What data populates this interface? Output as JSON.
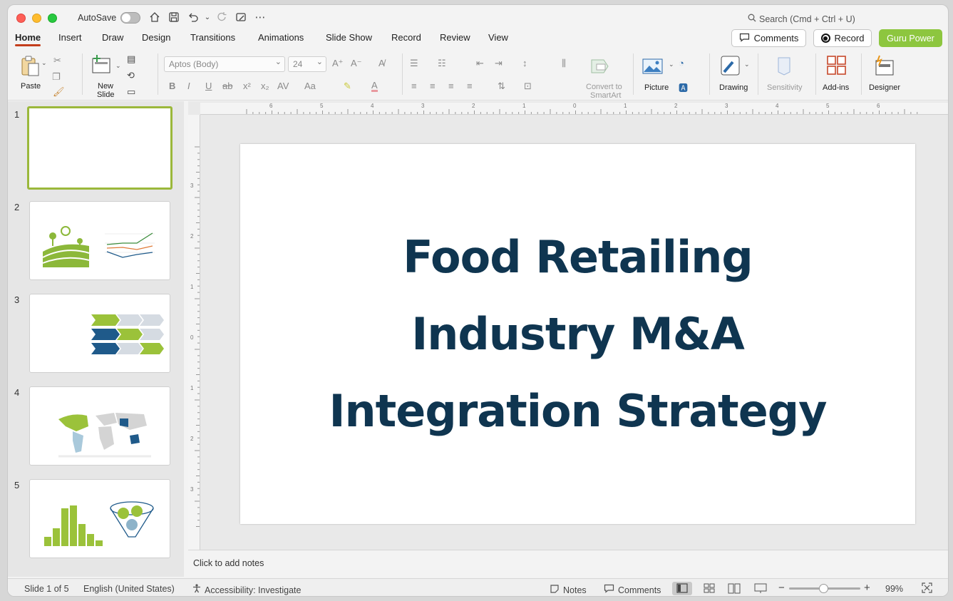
{
  "titlebar": {
    "autosave_label": "AutoSave",
    "search_placeholder": "Search (Cmd + Ctrl + U)"
  },
  "tabs": [
    {
      "label": "Home",
      "active": true
    },
    {
      "label": "Insert"
    },
    {
      "label": "Draw"
    },
    {
      "label": "Design"
    },
    {
      "label": "Transitions"
    },
    {
      "label": "Animations"
    },
    {
      "label": "Slide Show"
    },
    {
      "label": "Record"
    },
    {
      "label": "Review"
    },
    {
      "label": "View"
    }
  ],
  "actions": {
    "comments": "Comments",
    "record": "Record",
    "guru": "Guru Power"
  },
  "ribbon": {
    "paste": "Paste",
    "new_slide_line1": "New",
    "new_slide_line2": "Slide",
    "font_name": "Aptos (Body)",
    "font_size": "24",
    "smartart_line1": "Convert to",
    "smartart_line2": "SmartArt",
    "picture": "Picture",
    "drawing": "Drawing",
    "sensitivity": "Sensitivity",
    "addins": "Add-ins",
    "designer": "Designer"
  },
  "slides": [
    {
      "number": "1"
    },
    {
      "number": "2"
    },
    {
      "number": "3"
    },
    {
      "number": "4"
    },
    {
      "number": "5"
    }
  ],
  "rulers": {
    "h": [
      "6",
      "5",
      "4",
      "3",
      "2",
      "1",
      "0",
      "1",
      "2",
      "3",
      "4",
      "5",
      "6"
    ],
    "v": [
      "3",
      "2",
      "1",
      "0",
      "1",
      "2",
      "3"
    ]
  },
  "slide": {
    "title_line1": "Food Retailing",
    "title_line2": "Industry M&A",
    "title_line3": "Integration Strategy"
  },
  "notes_placeholder": "Click to add notes",
  "status": {
    "slide_of": "Slide 1 of 5",
    "language": "English (United States)",
    "accessibility": "Accessibility: Investigate",
    "notes": "Notes",
    "comments": "Comments",
    "zoom": "99%"
  },
  "colors": {
    "accent_green": "#8dc63f",
    "title_navy": "#0f3550",
    "tab_underline": "#c43e1c"
  }
}
